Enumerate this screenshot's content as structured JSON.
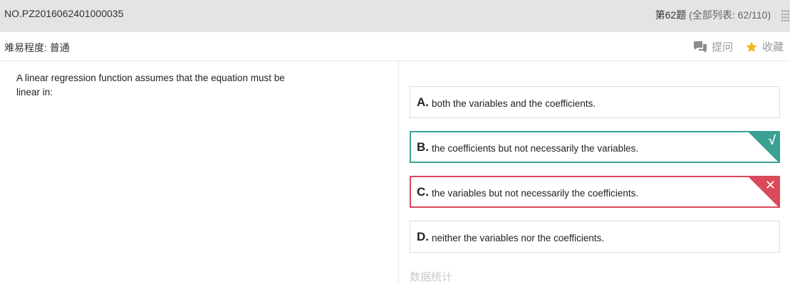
{
  "header": {
    "question_id": "NO.PZ2016062401000035",
    "question_number": "第62题",
    "list_info": "(全部列表: 62/110)"
  },
  "subheader": {
    "difficulty": "难易程度: 普通",
    "ask_label": "提问",
    "favorite_label": "收藏"
  },
  "question": {
    "text": "A linear regression function assumes that the equation must be linear in:"
  },
  "options": [
    {
      "letter": "A.",
      "text": "both the variables and the coefficients.",
      "state": "normal"
    },
    {
      "letter": "B.",
      "text": "the coefficients but not necessarily the variables.",
      "state": "correct",
      "mark": "√"
    },
    {
      "letter": "C.",
      "text": "the variables but not necessarily the coefficients.",
      "state": "wrong",
      "mark": "✕"
    },
    {
      "letter": "D.",
      "text": "neither the variables nor the coefficients.",
      "state": "normal"
    }
  ],
  "footer": {
    "stats_label": "数据统计"
  },
  "colors": {
    "correct": "#3aa193",
    "wrong": "#d94a5b",
    "star": "#f5b423",
    "topbar": "#e3e4e6"
  },
  "icons": {
    "ask": "chat-bubble-icon",
    "favorite": "star-icon",
    "menu": "grid-dots-icon"
  }
}
